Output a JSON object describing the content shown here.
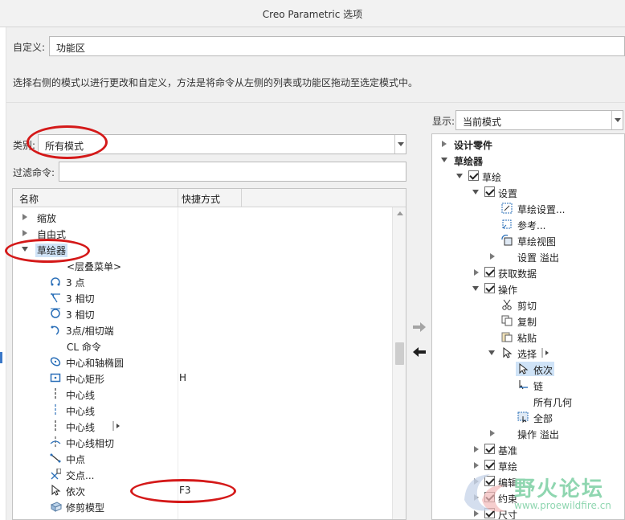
{
  "window": {
    "title": "Creo Parametric 选项"
  },
  "customize": {
    "label": "自定义:",
    "value": "功能区"
  },
  "instruction": "选择右侧的模式以进行更改和自定义，方法是将命令从左侧的列表或功能区拖动至选定模式中。",
  "category": {
    "label": "类别:",
    "value": "所有模式"
  },
  "filter": {
    "label": "过滤命令:",
    "value": ""
  },
  "left_columns": {
    "name": "名称",
    "shortcut": "快捷方式"
  },
  "left_tree": [
    {
      "label": "缩放",
      "shortcut": "",
      "icon": "collapsed-triangle"
    },
    {
      "label": "自由式",
      "shortcut": "",
      "icon": "collapsed-triangle"
    },
    {
      "label": "草绘器",
      "shortcut": "",
      "icon": "expanded-triangle"
    },
    {
      "label": "<层叠菜单>",
      "shortcut": "",
      "icon": "none"
    },
    {
      "label": "3 点",
      "shortcut": "",
      "icon": "arc-3point-icon"
    },
    {
      "label": "3 相切",
      "shortcut": "",
      "icon": "arc-3tangent-icon"
    },
    {
      "label": "3 相切",
      "shortcut": "",
      "icon": "circle-3tangent-icon"
    },
    {
      "label": "3点/相切端",
      "shortcut": "",
      "icon": "arc-tangent-end-icon"
    },
    {
      "label": "CL 命令",
      "shortcut": "",
      "icon": "none"
    },
    {
      "label": "中心和轴椭圆",
      "shortcut": "",
      "icon": "ellipse-icon"
    },
    {
      "label": "中心矩形",
      "shortcut": "H",
      "icon": "center-rectangle-icon"
    },
    {
      "label": "中心线",
      "shortcut": "",
      "icon": "centerline-icon"
    },
    {
      "label": "中心线",
      "shortcut": "",
      "icon": "centerline-icon"
    },
    {
      "label": "中心线",
      "shortcut": "",
      "icon": "centerline-icon"
    },
    {
      "label": "中心线相切",
      "shortcut": "",
      "icon": "centerline-tangent-icon"
    },
    {
      "label": "中点",
      "shortcut": "",
      "icon": "midpoint-icon"
    },
    {
      "label": "交点...",
      "shortcut": "",
      "icon": "intersection-icon"
    },
    {
      "label": "依次",
      "shortcut": "F3",
      "icon": "select-arrow-icon"
    },
    {
      "label": "修剪模型",
      "shortcut": "",
      "icon": "trim-model-icon"
    }
  ],
  "display": {
    "label": "显示:",
    "value": "当前模式"
  },
  "right_tree": {
    "root": "设计零件",
    "sketcher_tab": "草绘器",
    "group_sketch": "草绘",
    "setup": "设置",
    "setup_items": [
      "草绘设置...",
      "参考...",
      "草绘视图"
    ],
    "setup_overflow": "设置 溢出",
    "get_data": "获取数据",
    "operations": "操作",
    "ops_items": [
      "剪切",
      "复制",
      "粘贴"
    ],
    "select": "选择",
    "select_items": [
      "依次",
      "链",
      "所有几何",
      "全部"
    ],
    "ops_overflow": "操作 溢出",
    "groups_after": [
      "基准",
      "草绘",
      "编辑",
      "约束",
      "尺寸"
    ]
  },
  "watermark": {
    "text": "野火论坛",
    "url": "www.proewildfire.cn"
  },
  "colors": {
    "selection": "#cfe3f7",
    "annotation_red": "#d41919",
    "dialog_bg": "#f0f0f0"
  }
}
